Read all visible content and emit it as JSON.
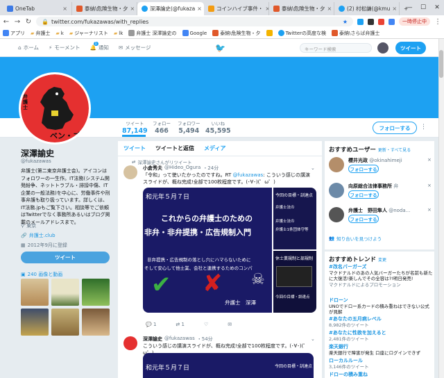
{
  "browser": {
    "tabs": [
      {
        "label": "OneTab",
        "color": "#3d7ae5"
      },
      {
        "label": "泰納\\危険生物・夕",
        "color": "#e0582a"
      },
      {
        "label": "深澤論史(@fukaza",
        "color": "#1da1f2"
      },
      {
        "label": "コインハイブ事件・",
        "color": "#f39c12"
      },
      {
        "label": "泰納\\危険生物・夕",
        "color": "#e0582a"
      },
      {
        "label": "(2) 村松謙(@kmu",
        "color": "#1da1f2"
      }
    ],
    "url": "twitter.com/fukazawas/with_replies",
    "pause_label": "一時停止中",
    "bookmarks": [
      "アプリ",
      "弁護士",
      "k",
      "ジャーナリスト",
      "lk",
      "弁護士 深澤論史の",
      "Google",
      "泰納\\危険生物・夕",
      "",
      "Twitterの高度な検",
      "泰納\\さらば弁護士"
    ]
  },
  "twitter_nav": {
    "items": [
      "ホーム",
      "モーメント",
      "通知",
      "メッセージ"
    ],
    "notif_count": "1",
    "search_placeholder": "キーワード検索",
    "tweet_button": "ツイート"
  },
  "profile": {
    "avatar_text": "ベン・ゴジ",
    "avatar_side_text": "弁護士",
    "name": "深澤諭史",
    "handle": "@fukazawas",
    "bio": "弁護士(第二東京弁護士会)。アイコンはフォロワーの一生作。IT法務(システム開発紛争、ネットトラブル・誹謗中傷、IT企業の一般法務)を中心に、労働事件や刑事弁護も取り扱っています。詳しくは、IT法務.jpもご覧下さい。相談等でご依頼はTwitterでなく事務所あるいはブログ掲載のメールアドレスまで。",
    "location": "東京",
    "website": "弁護士.club",
    "joined": "2012年9月に登録",
    "tweet_button": "ツイート",
    "media_label": "240 画像と動画",
    "thumb_colors": [
      "#b58a55",
      "#5a7a3a",
      "#2f6e2a",
      "#3e4d6b",
      "#c5b27a",
      "#7a5a3a"
    ]
  },
  "stats": [
    {
      "label": "ツイート",
      "value": "87,149"
    },
    {
      "label": "フォロー",
      "value": "466"
    },
    {
      "label": "フォロワー",
      "value": "5,494"
    },
    {
      "label": "いいね",
      "value": "45,595"
    }
  ],
  "follow_button": "フォローする",
  "timeline": {
    "tabs": [
      "ツイート",
      "ツイートと返信",
      "メディア"
    ],
    "tweet1": {
      "retweeted_by": "深澤諭史さんがリツイート",
      "name": "小倉秀夫",
      "handle": "@Hideo_Ogura",
      "time": "・24分",
      "text_pre": "「令和」って使いたかったのですね。RT ",
      "mention": "@fukazawas",
      "text_post": ": こういう感じの講演スライドが、概ね完成!全部で100枚程度です。(･∀･)(゜ω゜)",
      "slide_date": "和元年５月７日",
      "slide_line1": "これからの弁護士のための",
      "slide_line2": "非弁・非弁提携・広告規制入門",
      "slide_small1": "非弁提携・広告規制の落とし穴にハマらないために",
      "slide_small2": "そして安心して他士業、会社と連携するためのコンパ",
      "slide_speaker": "弁護士　深澤",
      "side_top1": "今回の目標・訓達点",
      "side_top2": "弁護士法の",
      "side_mid1": "弁護士法の",
      "side_mid2": "弁護士1条団体守等",
      "side_bot1": "休士業規制と部規制",
      "side_bot2": "今回の目標・訓達点",
      "reply_count": "1",
      "retweet_count": "1"
    },
    "tweet2": {
      "name": "深澤諭史",
      "handle": "@fukazawas",
      "time": "・54分",
      "text": "こういう感じの講演スライドが、概ね完成!全部で100枚程度です。(･∀･)(゜ω゜)",
      "slide_date": "和元年５月７日",
      "side_top1": "今回の目標・訓達点"
    }
  },
  "suggestions": {
    "title": "おすすめユーザー",
    "links": "更新・すべて見る",
    "users": [
      {
        "name": "櫻井光政",
        "handle": "@okinahimeji",
        "button": "フォローする",
        "color": "#b48e6a"
      },
      {
        "name": "向原総合法律事務所",
        "handle": "弁",
        "button": "フォローする",
        "color": "#6c8aa8"
      },
      {
        "name": "弁護士　野田隼人",
        "handle": "@noda...",
        "button": "フォローする",
        "color": "#555"
      }
    ],
    "find_friends": "知り合いを見つけよう"
  },
  "trends": {
    "title": "おすすめトレンド",
    "links": "変更",
    "items": [
      {
        "tag": "#改名バーガーズ",
        "desc": "マクドナルドのあの人気バーガーたちが名前も新たに大復活!楽しんでその全容は?!明日発売!",
        "meta": "マクドナルドによるプロモーション"
      },
      {
        "tag": "ドローン",
        "desc": "UNOでドロー系カードの積み重ねはできない公式が見解",
        "meta": ""
      },
      {
        "tag": "#あなたの五月病レベル",
        "desc": "",
        "meta": "8,982件のツイート"
      },
      {
        "tag": "#あなたに性欲を加えると",
        "desc": "",
        "meta": "2,481件のツイート"
      },
      {
        "tag": "楽天銀行",
        "desc": "楽天銀行で障害が発生 口座にログインできず",
        "meta": ""
      },
      {
        "tag": "ローカルルール",
        "desc": "",
        "meta": "3,146件のツイート"
      },
      {
        "tag": "ドローの積み重ね",
        "desc": "",
        "meta": ""
      }
    ]
  }
}
